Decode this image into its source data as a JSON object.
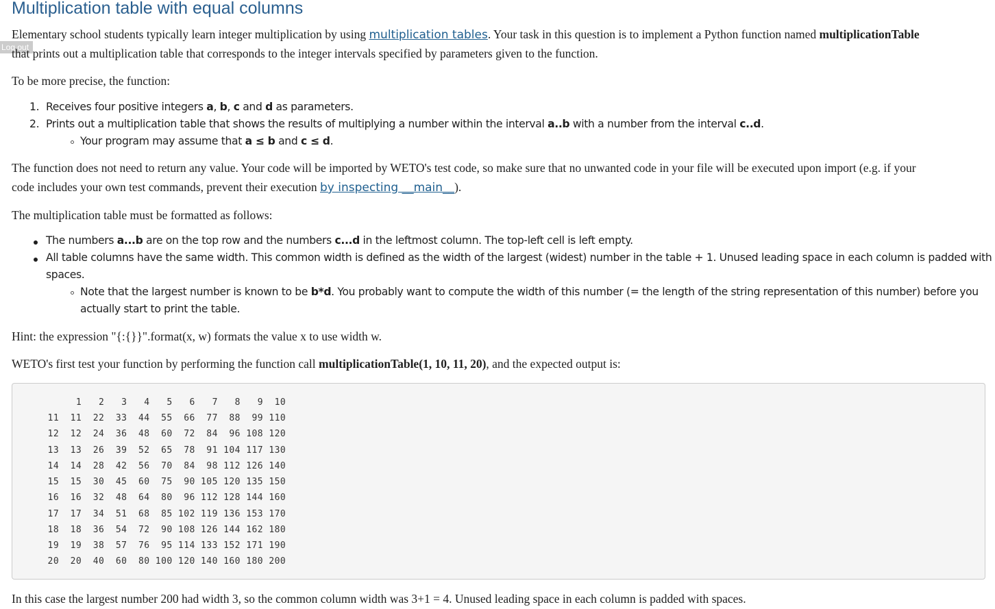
{
  "title": "Multiplication table with equal columns",
  "logout_label": "Log out",
  "intro": {
    "text1": "Elementary school students typically learn integer multiplication by using ",
    "link": "multiplication tables",
    "text2": ". Your task in this question is to implement a Python function named ",
    "func": "multiplicationTable",
    "text3": "that prints out a multiplication table that corresponds to the integer intervals specified by parameters given to the function."
  },
  "precise": "To be more precise, the function:",
  "list1": {
    "item1": {
      "marker": "1.",
      "t1": "Receives four positive integers ",
      "a": "a",
      "s1": ", ",
      "b": "b",
      "s2": ", ",
      "c": "c",
      "s3": " and ",
      "d": "d",
      "t2": " as parameters."
    },
    "item2": {
      "marker": "2.",
      "t1": "Prints out a multiplication table that shows the results of multiplying a number within the interval ",
      "ab": "a..b",
      "t2": " with a number from the interval ",
      "cd": "c..d",
      "t3": "."
    },
    "sub": {
      "t1": "Your program may assume that ",
      "ab": "a ≤ b",
      "t2": " and ",
      "cd": "c ≤ d",
      "t3": "."
    }
  },
  "para_return": {
    "line1": "The function does not need to return any value. Your code will be imported by WETO's test code, so make sure that no unwanted code in your file will be executed upon import (e.g. if your",
    "line2_text": "code includes your own test commands, prevent their execution ",
    "line2_link": "by inspecting __main__",
    "line2_end": ")."
  },
  "format_intro": "The multiplication table must be formatted as follows:",
  "list2": {
    "item1": {
      "t1": "The numbers ",
      "ab": "a...b",
      "t2": " are on the top row and the numbers ",
      "cd": "c...d",
      "t3": " in the leftmost column. The top-left cell is left empty."
    },
    "item2_line1": "All table columns have the same width. This common width is defined as the width of the largest (widest) number in the table + 1. Unused leading space in each column is padded with",
    "item2_line2": "spaces.",
    "sub_t1": "Note that the largest number is known to be ",
    "sub_bd": "b*d",
    "sub_line1_rest": ". You probably want to compute the width of this number (= the length of the string representation of this number) before you",
    "sub_line2": "actually start to print the table."
  },
  "hint": "Hint: the expression \"{:{}}\".format(x, w) formats the value x to use width w.",
  "first_test": {
    "t1": "WETO's first test your function by performing the function call ",
    "call": "multiplicationTable(1, 10, 11, 20)",
    "t2": ", and the expected output is:"
  },
  "output_lines": [
    "       1   2   3   4   5   6   7   8   9  10",
    "  11  11  22  33  44  55  66  77  88  99 110",
    "  12  12  24  36  48  60  72  84  96 108 120",
    "  13  13  26  39  52  65  78  91 104 117 130",
    "  14  14  28  42  56  70  84  98 112 126 140",
    "  15  15  30  45  60  75  90 105 120 135 150",
    "  16  16  32  48  64  80  96 112 128 144 160",
    "  17  17  34  51  68  85 102 119 136 153 170",
    "  18  18  36  54  72  90 108 126 144 162 180",
    "  19  19  38  57  76  95 114 133 152 171 190",
    "  20  20  40  60  80 100 120 140 160 180 200"
  ],
  "conclusion": "In this case the largest number 200 had width 3, so the common column width was 3+1 = 4. Unused leading space in each column is padded with spaces."
}
